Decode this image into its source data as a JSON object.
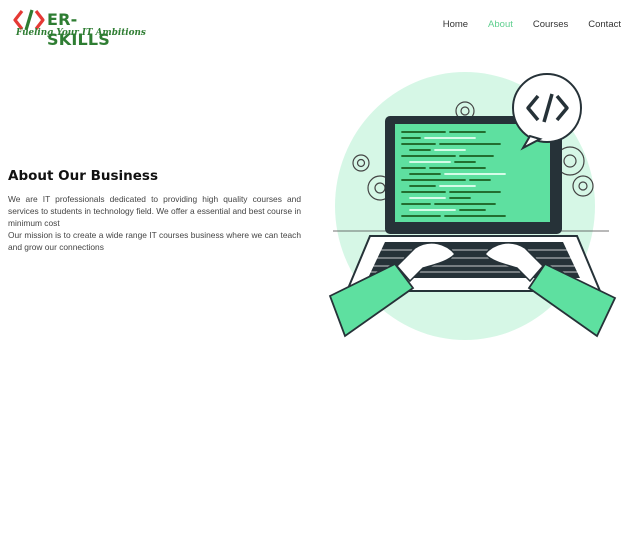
{
  "brand": {
    "name": "ER-SKILLS",
    "tagline": "Fueling Your IT Ambitions",
    "mark_colors": [
      "#e53935",
      "#2e7d32"
    ]
  },
  "nav": {
    "items": [
      {
        "label": "Home",
        "active": false
      },
      {
        "label": "About",
        "active": true
      },
      {
        "label": "Courses",
        "active": false
      },
      {
        "label": "Contact",
        "active": false
      }
    ]
  },
  "about": {
    "title": "About Our Business",
    "paragraph1": "We are IT professionals dedicated to providing high quality courses and services to students in technology field. We offer a essential and best course in minimum cost",
    "paragraph2": "Our mission is to create a wide range IT courses business where we can teach and grow our connections"
  },
  "illustration": {
    "description_icon": "laptop-coding-icon",
    "code_bubble_glyph": "</>",
    "accent": "#5ee0a0",
    "dark": "#263238"
  },
  "colors": {
    "accent": "#5fcf8f",
    "brand_green": "#2e7d32",
    "brand_red": "#e53935"
  }
}
